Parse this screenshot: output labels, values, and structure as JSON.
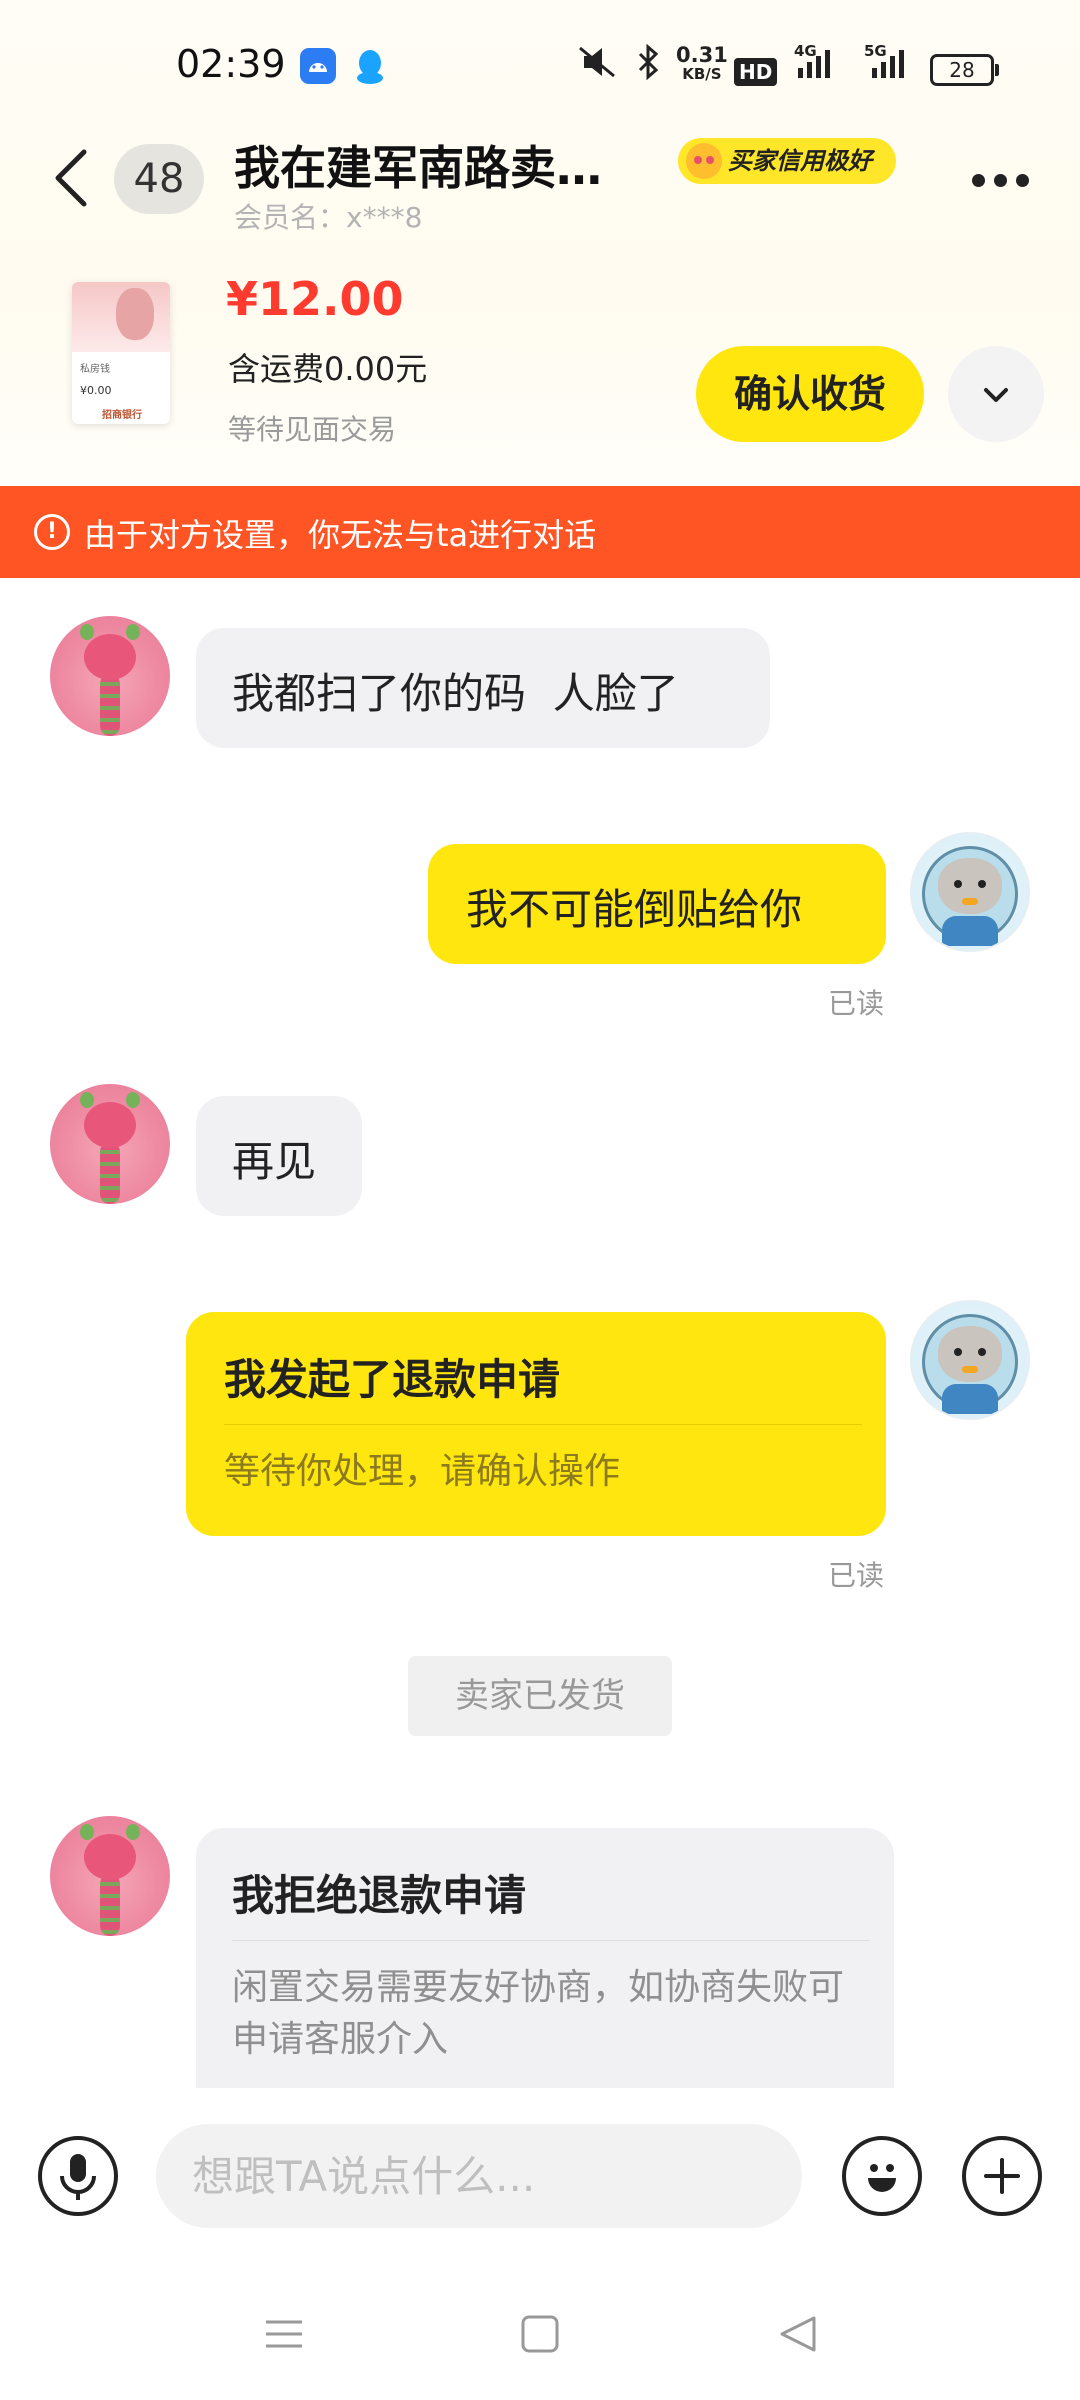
{
  "status_bar": {
    "time": "02:39",
    "net_speed_value": "0.31",
    "net_speed_unit": "KB/S",
    "hd_label": "HD",
    "network_4g": "4G",
    "network_5g": "5G",
    "battery": "28",
    "icons": [
      "android-app-icon",
      "qq-icon",
      "mute-icon",
      "bluetooth-icon",
      "hd-icon",
      "signal-4g-icon",
      "signal-5g-icon",
      "battery-icon"
    ]
  },
  "header": {
    "unread_count": "48",
    "title": "我在建军南路卖…",
    "credit_badge": "买家信用极好",
    "member_label": "会员名：x***8"
  },
  "product": {
    "price": "¥12.00",
    "shipping": "含运费0.00元",
    "status": "等待见面交易",
    "confirm_button": "确认收货",
    "thumb": {
      "line1": "私房钱",
      "line2": "¥0.00",
      "line3": "招商银行"
    }
  },
  "warning": {
    "text": "由于对方设置，你无法与ta进行对话",
    "color": "#ff5424"
  },
  "messages": [
    {
      "side": "in",
      "text": "我都扫了你的码  人脸了"
    },
    {
      "side": "out",
      "text": "我不可能倒贴给你",
      "read": "已读"
    },
    {
      "side": "in",
      "text": "再见"
    },
    {
      "side": "out",
      "card_title": "我发起了退款申请",
      "card_sub": "等待你处理，请确认操作",
      "read": "已读"
    },
    {
      "side": "system",
      "text": "卖家已发货"
    },
    {
      "side": "in",
      "card_title": "我拒绝退款申请",
      "card_sub": "闲置交易需要友好协商，如协商失败可申请客服介入"
    }
  ],
  "input": {
    "placeholder": "想跟TA说点什么..."
  },
  "colors": {
    "accent_yellow": "#ffe60f",
    "price_red": "#ff3b30",
    "warning_orange": "#ff5424"
  }
}
